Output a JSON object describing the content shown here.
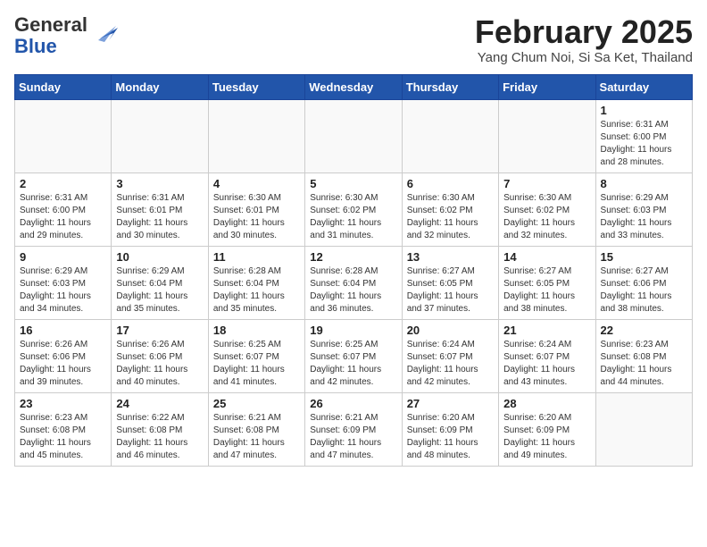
{
  "header": {
    "logo_general": "General",
    "logo_blue": "Blue",
    "month_title": "February 2025",
    "location": "Yang Chum Noi, Si Sa Ket, Thailand"
  },
  "weekdays": [
    "Sunday",
    "Monday",
    "Tuesday",
    "Wednesday",
    "Thursday",
    "Friday",
    "Saturday"
  ],
  "weeks": [
    [
      {
        "day": "",
        "info": ""
      },
      {
        "day": "",
        "info": ""
      },
      {
        "day": "",
        "info": ""
      },
      {
        "day": "",
        "info": ""
      },
      {
        "day": "",
        "info": ""
      },
      {
        "day": "",
        "info": ""
      },
      {
        "day": "1",
        "info": "Sunrise: 6:31 AM\nSunset: 6:00 PM\nDaylight: 11 hours and 28 minutes."
      }
    ],
    [
      {
        "day": "2",
        "info": "Sunrise: 6:31 AM\nSunset: 6:00 PM\nDaylight: 11 hours and 29 minutes."
      },
      {
        "day": "3",
        "info": "Sunrise: 6:31 AM\nSunset: 6:01 PM\nDaylight: 11 hours and 30 minutes."
      },
      {
        "day": "4",
        "info": "Sunrise: 6:30 AM\nSunset: 6:01 PM\nDaylight: 11 hours and 30 minutes."
      },
      {
        "day": "5",
        "info": "Sunrise: 6:30 AM\nSunset: 6:02 PM\nDaylight: 11 hours and 31 minutes."
      },
      {
        "day": "6",
        "info": "Sunrise: 6:30 AM\nSunset: 6:02 PM\nDaylight: 11 hours and 32 minutes."
      },
      {
        "day": "7",
        "info": "Sunrise: 6:30 AM\nSunset: 6:02 PM\nDaylight: 11 hours and 32 minutes."
      },
      {
        "day": "8",
        "info": "Sunrise: 6:29 AM\nSunset: 6:03 PM\nDaylight: 11 hours and 33 minutes."
      }
    ],
    [
      {
        "day": "9",
        "info": "Sunrise: 6:29 AM\nSunset: 6:03 PM\nDaylight: 11 hours and 34 minutes."
      },
      {
        "day": "10",
        "info": "Sunrise: 6:29 AM\nSunset: 6:04 PM\nDaylight: 11 hours and 35 minutes."
      },
      {
        "day": "11",
        "info": "Sunrise: 6:28 AM\nSunset: 6:04 PM\nDaylight: 11 hours and 35 minutes."
      },
      {
        "day": "12",
        "info": "Sunrise: 6:28 AM\nSunset: 6:04 PM\nDaylight: 11 hours and 36 minutes."
      },
      {
        "day": "13",
        "info": "Sunrise: 6:27 AM\nSunset: 6:05 PM\nDaylight: 11 hours and 37 minutes."
      },
      {
        "day": "14",
        "info": "Sunrise: 6:27 AM\nSunset: 6:05 PM\nDaylight: 11 hours and 38 minutes."
      },
      {
        "day": "15",
        "info": "Sunrise: 6:27 AM\nSunset: 6:06 PM\nDaylight: 11 hours and 38 minutes."
      }
    ],
    [
      {
        "day": "16",
        "info": "Sunrise: 6:26 AM\nSunset: 6:06 PM\nDaylight: 11 hours and 39 minutes."
      },
      {
        "day": "17",
        "info": "Sunrise: 6:26 AM\nSunset: 6:06 PM\nDaylight: 11 hours and 40 minutes."
      },
      {
        "day": "18",
        "info": "Sunrise: 6:25 AM\nSunset: 6:07 PM\nDaylight: 11 hours and 41 minutes."
      },
      {
        "day": "19",
        "info": "Sunrise: 6:25 AM\nSunset: 6:07 PM\nDaylight: 11 hours and 42 minutes."
      },
      {
        "day": "20",
        "info": "Sunrise: 6:24 AM\nSunset: 6:07 PM\nDaylight: 11 hours and 42 minutes."
      },
      {
        "day": "21",
        "info": "Sunrise: 6:24 AM\nSunset: 6:07 PM\nDaylight: 11 hours and 43 minutes."
      },
      {
        "day": "22",
        "info": "Sunrise: 6:23 AM\nSunset: 6:08 PM\nDaylight: 11 hours and 44 minutes."
      }
    ],
    [
      {
        "day": "23",
        "info": "Sunrise: 6:23 AM\nSunset: 6:08 PM\nDaylight: 11 hours and 45 minutes."
      },
      {
        "day": "24",
        "info": "Sunrise: 6:22 AM\nSunset: 6:08 PM\nDaylight: 11 hours and 46 minutes."
      },
      {
        "day": "25",
        "info": "Sunrise: 6:21 AM\nSunset: 6:08 PM\nDaylight: 11 hours and 47 minutes."
      },
      {
        "day": "26",
        "info": "Sunrise: 6:21 AM\nSunset: 6:09 PM\nDaylight: 11 hours and 47 minutes."
      },
      {
        "day": "27",
        "info": "Sunrise: 6:20 AM\nSunset: 6:09 PM\nDaylight: 11 hours and 48 minutes."
      },
      {
        "day": "28",
        "info": "Sunrise: 6:20 AM\nSunset: 6:09 PM\nDaylight: 11 hours and 49 minutes."
      },
      {
        "day": "",
        "info": ""
      }
    ]
  ]
}
